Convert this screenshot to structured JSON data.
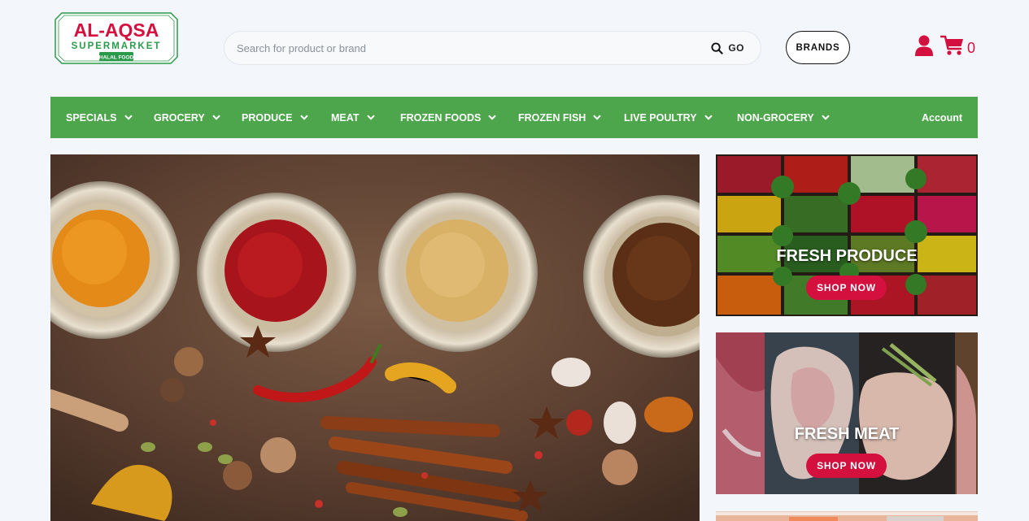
{
  "logo": {
    "main_text": "AL-AQSA",
    "sub_text": "SUPERMARKET",
    "tag_text": "HALAL FOOD"
  },
  "search": {
    "placeholder": "Search for product or brand",
    "button_label": "GO",
    "icon": "search-icon"
  },
  "header": {
    "brands_label": "BRANDS",
    "user_icon": "user-icon",
    "cart_icon": "cart-icon",
    "cart_count": "0"
  },
  "nav": {
    "items": [
      {
        "label": "SPECIALS"
      },
      {
        "label": "GROCERY"
      },
      {
        "label": "PRODUCE"
      },
      {
        "label": "MEAT"
      },
      {
        "label": "FROZEN FOODS"
      },
      {
        "label": "FROZEN FISH"
      },
      {
        "label": "LIVE POULTRY"
      },
      {
        "label": "NON-GROCERY"
      }
    ],
    "account_label": "Account"
  },
  "banners": [
    {
      "title": "FRESH PRODUCE",
      "button_label": "SHOP NOW"
    },
    {
      "title": "FRESH MEAT",
      "button_label": "SHOP NOW"
    }
  ],
  "colors": {
    "brand_green": "#4ea64c",
    "accent_red": "#d3103e",
    "page_background": "#f3f6fa"
  }
}
